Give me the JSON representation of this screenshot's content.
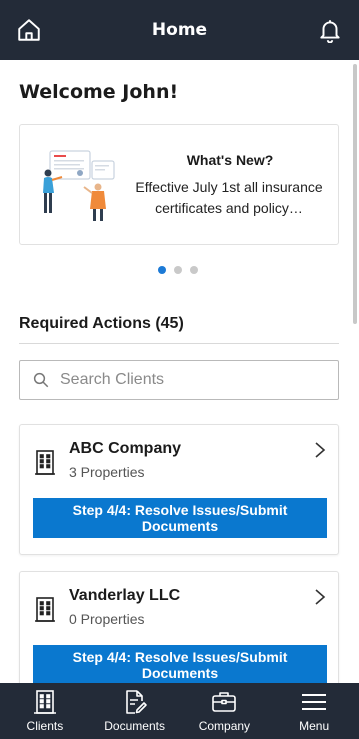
{
  "header": {
    "title": "Home",
    "home_icon": "home-icon",
    "bell_icon": "bell-icon"
  },
  "welcome": "Welcome John!",
  "news": {
    "title": "What's New?",
    "body": "Effective July 1st all insurance certificates and policy…",
    "dots": 3,
    "active_dot": 0
  },
  "required_actions": {
    "title": "Required Actions (45)"
  },
  "search": {
    "placeholder": "Search Clients",
    "value": ""
  },
  "clients": [
    {
      "name": "ABC Company",
      "properties": "3 Properties",
      "action": "Step 4/4: Resolve Issues/Submit Documents"
    },
    {
      "name": "Vanderlay LLC",
      "properties": "0 Properties",
      "action": "Step 4/4: Resolve Issues/Submit Documents"
    }
  ],
  "nav": [
    {
      "label": "Clients",
      "icon": "building-icon"
    },
    {
      "label": "Documents",
      "icon": "document-edit-icon"
    },
    {
      "label": "Company",
      "icon": "briefcase-icon"
    },
    {
      "label": "Menu",
      "icon": "hamburger-menu-icon"
    }
  ],
  "colors": {
    "header_bg": "#232b38",
    "accent": "#0a78cf",
    "dot_active": "#1c7ad6"
  }
}
